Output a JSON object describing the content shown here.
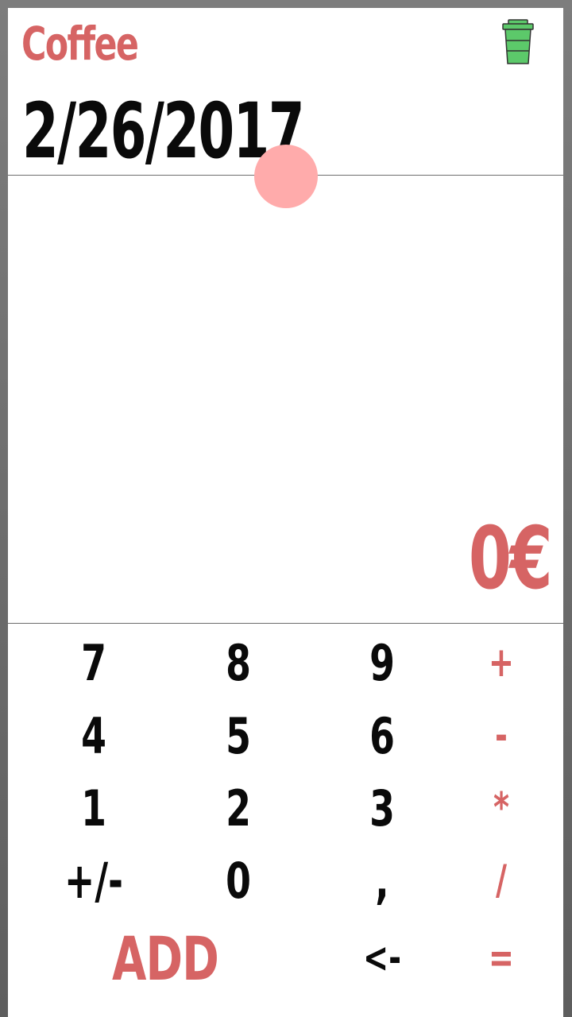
{
  "header": {
    "title": "Coffee",
    "date": "2/26/2017",
    "category_icon": "coffee-cup-icon",
    "category_icon_color": "#5cc96a"
  },
  "display": {
    "amount": "0€"
  },
  "keypad": {
    "keys": [
      [
        "7",
        "8",
        "9",
        "+"
      ],
      [
        "4",
        "5",
        "6",
        "-"
      ],
      [
        "1",
        "2",
        "3",
        "*"
      ],
      [
        "+/-",
        "0",
        ",",
        "/"
      ]
    ],
    "add_label": "ADD",
    "backspace_label": "<-",
    "equals_label": "="
  },
  "colors": {
    "accent": "#d66464",
    "fab": "#ffabab",
    "text": "#0a0a0a",
    "background": "#ffffff"
  }
}
